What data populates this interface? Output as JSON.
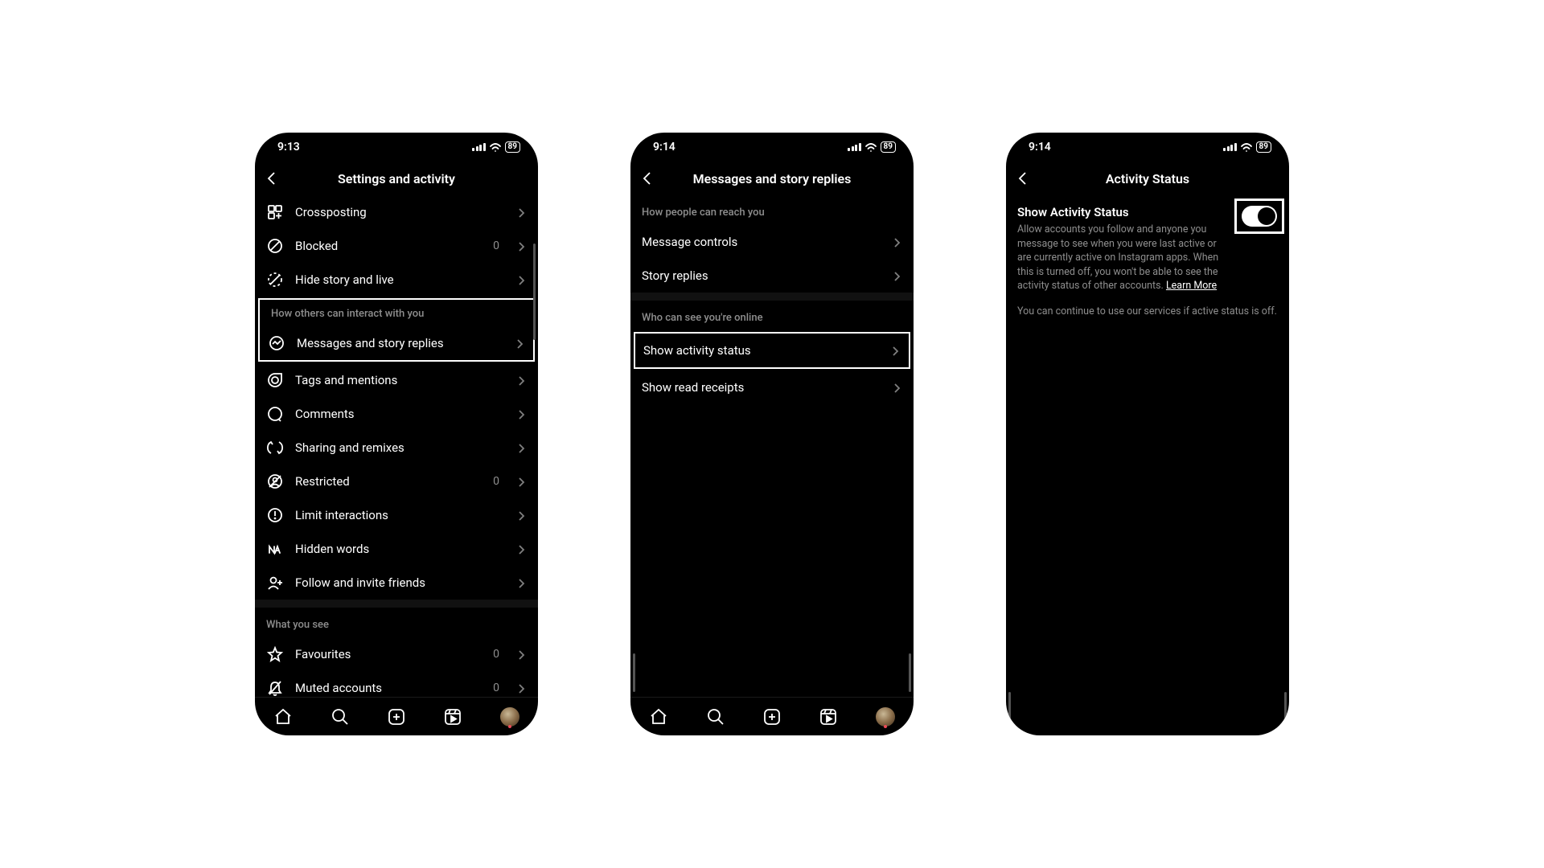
{
  "screen1": {
    "time": "9:13",
    "battery": "89",
    "title": "Settings and activity",
    "rows_top": [
      {
        "icon": "crossposting",
        "label": "Crossposting",
        "badge": null
      },
      {
        "icon": "blocked",
        "label": "Blocked",
        "badge": "0"
      },
      {
        "icon": "hidestory",
        "label": "Hide story and live",
        "badge": null
      }
    ],
    "section_interact": "How others can interact with you",
    "row_messages": {
      "icon": "messenger",
      "label": "Messages and story replies"
    },
    "rows_interact": [
      {
        "icon": "tags",
        "label": "Tags and mentions",
        "badge": null
      },
      {
        "icon": "comments",
        "label": "Comments",
        "badge": null
      },
      {
        "icon": "sharing",
        "label": "Sharing and remixes",
        "badge": null
      },
      {
        "icon": "restricted",
        "label": "Restricted",
        "badge": "0"
      },
      {
        "icon": "limit",
        "label": "Limit interactions",
        "badge": null
      },
      {
        "icon": "hidden",
        "label": "Hidden words",
        "badge": null
      },
      {
        "icon": "follow",
        "label": "Follow and invite friends",
        "badge": null
      }
    ],
    "section_see": "What you see",
    "rows_see": [
      {
        "icon": "star",
        "label": "Favourites",
        "badge": "0"
      },
      {
        "icon": "muted",
        "label": "Muted accounts",
        "badge": "0"
      }
    ]
  },
  "screen2": {
    "time": "9:14",
    "battery": "89",
    "title": "Messages and story replies",
    "section_reach": "How people can reach you",
    "rows_reach": [
      {
        "label": "Message controls"
      },
      {
        "label": "Story replies"
      }
    ],
    "section_online": "Who can see you're online",
    "row_activity": {
      "label": "Show activity status"
    },
    "rows_online2": [
      {
        "label": "Show read receipts"
      }
    ]
  },
  "screen3": {
    "time": "9:14",
    "battery": "89",
    "title": "Activity Status",
    "heading": "Show Activity Status",
    "description": "Allow accounts you follow and anyone you message to see when you were last active or are currently active on Instagram apps. When this is turned off, you won't be able to see the activity status of other accounts. ",
    "learn_more": "Learn More",
    "sub": "You can continue to use our services if active status is off."
  }
}
